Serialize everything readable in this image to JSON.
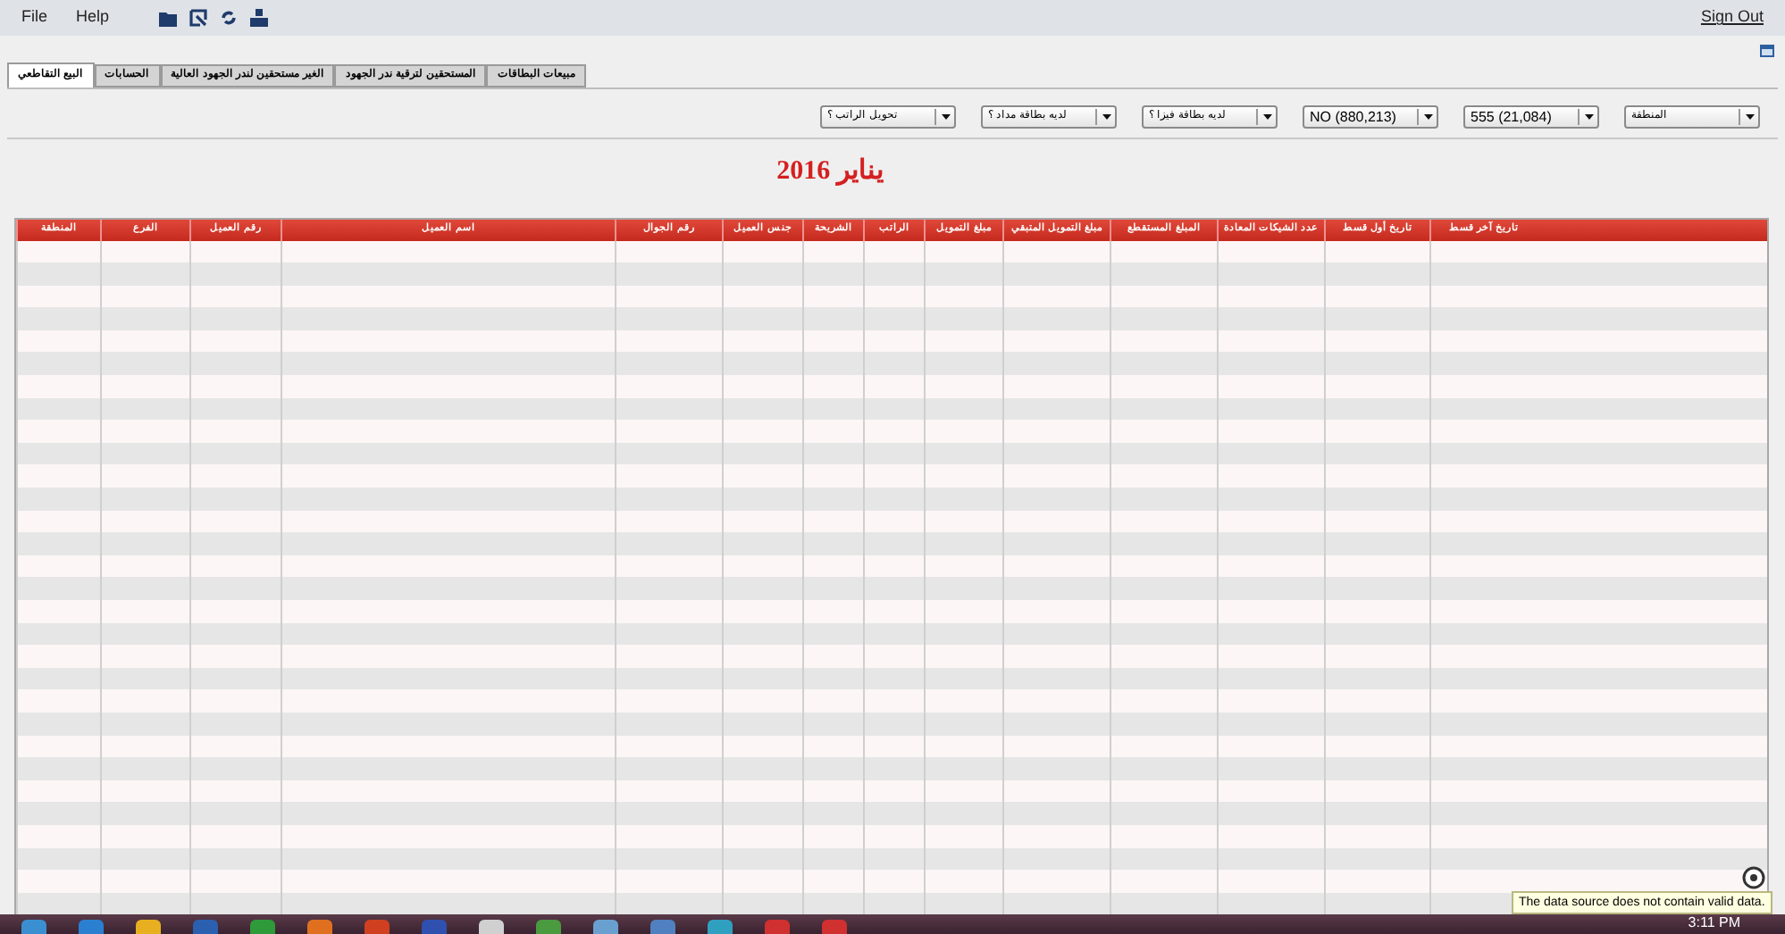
{
  "menu": [
    {
      "label": "Help"
    },
    {
      "label": "File"
    }
  ],
  "sign_out": "Sign Out",
  "tabs": [
    {
      "label": "مبيعات البطاقات",
      "selected": false
    },
    {
      "label": "المستحقين لترقية ندر الجهود",
      "selected": false
    },
    {
      "label": "الغير مستحقين لندر الجهود العالية",
      "selected": false
    },
    {
      "label": "الحسابات",
      "selected": false
    },
    {
      "label": "البيع التقاطعي",
      "selected": true
    }
  ],
  "filters": [
    {
      "value": "المنطقة"
    },
    {
      "value": "555 (21,084)"
    },
    {
      "value": "NO (880,213)"
    },
    {
      "value": "لديه بطاقة فيزا ؟"
    },
    {
      "value": "لديه بطاقة مداد ؟"
    },
    {
      "value": "تحويل الراتب ؟"
    }
  ],
  "report_title": "يناير 2016",
  "table": {
    "columns": [
      "تاريخ آخر قسط",
      "تاريخ أول قسط",
      "عدد الشيكات المعادة",
      "المبلغ المستقطع",
      "مبلغ التمويل المتبقي",
      "مبلغ التمويل",
      "الراتب",
      "الشريحة",
      "جنس العميل",
      "رقم الجوال",
      "اسم العميل",
      "رقم العميل",
      "الفرع",
      "المنطقة"
    ]
  },
  "tooltip": "The data source does not contain valid data.",
  "taskbar": {
    "clock": "3:11 PM"
  }
}
